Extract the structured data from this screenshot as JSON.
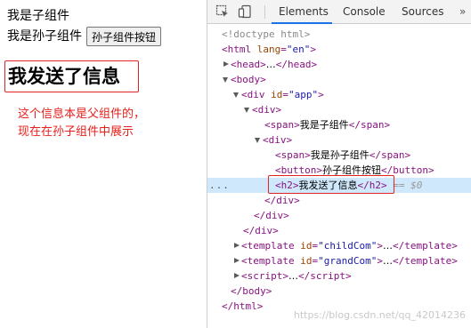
{
  "page": {
    "child_text": "我是子组件",
    "grandchild_text": "我是孙子组件",
    "grandchild_button": "孙子组件按钮",
    "message_heading": "我发送了信息",
    "note_line1": "这个信息本是父组件的，",
    "note_line2": "现在在孙子组件中展示"
  },
  "devtools": {
    "tabs": [
      "Elements",
      "Console",
      "Sources"
    ],
    "active_tab": "Elements",
    "watermark": "https://blog.csdn.net/qq_42014236",
    "tree": {
      "doctype": "<!doctype html>",
      "html_tag": "html",
      "html_attr_name": "lang",
      "html_attr_value": "\"en\"",
      "head": "head",
      "body": "body",
      "div": "div",
      "div_attr_name": "id",
      "div_attr_value": "\"app\"",
      "span_tag": "span",
      "span_child_text": "我是子组件",
      "span_grandchild_text": "我是孙子组件",
      "button_tag": "button",
      "button_text": "孙子组件按钮",
      "h2_tag": "h2",
      "h2_text": "我发送了信息",
      "eq_marker": "== $0",
      "template_tag": "template",
      "template_attr": "id",
      "template1_id": "\"childCom\"",
      "template2_id": "\"grandCom\"",
      "script_tag": "script",
      "ellipsis": "…",
      "dots": "..."
    }
  },
  "colors": {
    "accent": "#1a73e8",
    "annotation_red": "#e8201c",
    "selected_row": "#cfe8fc"
  }
}
